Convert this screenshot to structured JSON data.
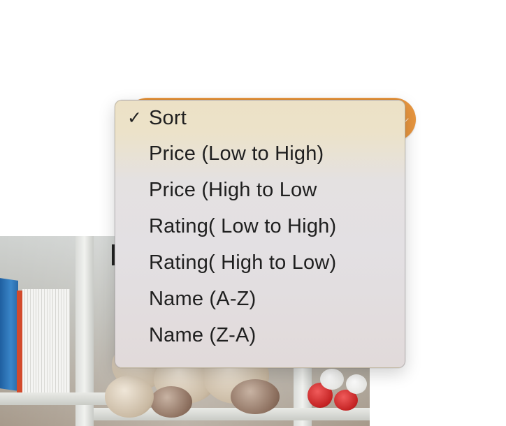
{
  "sort_menu": {
    "selected_index": 0,
    "check_glyph": "✓",
    "items": [
      {
        "label": "Sort"
      },
      {
        "label": "Price (Low to High)"
      },
      {
        "label": "Price (High to Low"
      },
      {
        "label": "Rating( Low to High)"
      },
      {
        "label": "Rating( High to Low)"
      },
      {
        "label": "Name (A-Z)"
      },
      {
        "label": "Name (Z-A)"
      }
    ]
  },
  "colors": {
    "select_accent": "#e8963f",
    "menu_text": "#1f1f1f"
  },
  "icons": {
    "select_chevron": "chevron-down-icon",
    "checkmark": "checkmark-icon"
  }
}
